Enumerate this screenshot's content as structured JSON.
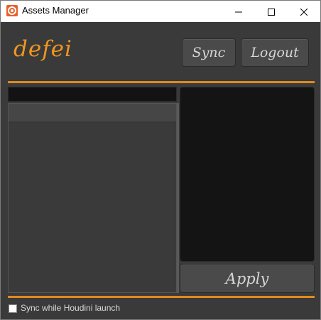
{
  "window": {
    "title": "Assets Manager",
    "app_icon": "houdini-icon",
    "controls": [
      "minimize-icon",
      "maximize-icon",
      "close-icon"
    ]
  },
  "header": {
    "username": "defei",
    "sync_label": "Sync",
    "logout_label": "Logout"
  },
  "assets": {
    "search_value": "",
    "items": []
  },
  "preview": {
    "apply_label": "Apply"
  },
  "footer": {
    "sync_on_launch_label": "Sync while Houdini launch",
    "sync_on_launch_checked": false
  },
  "colors": {
    "accent": "#e08a1c",
    "username": "#f0961e",
    "background": "#3a3a3a",
    "panel_dark": "#141414"
  }
}
